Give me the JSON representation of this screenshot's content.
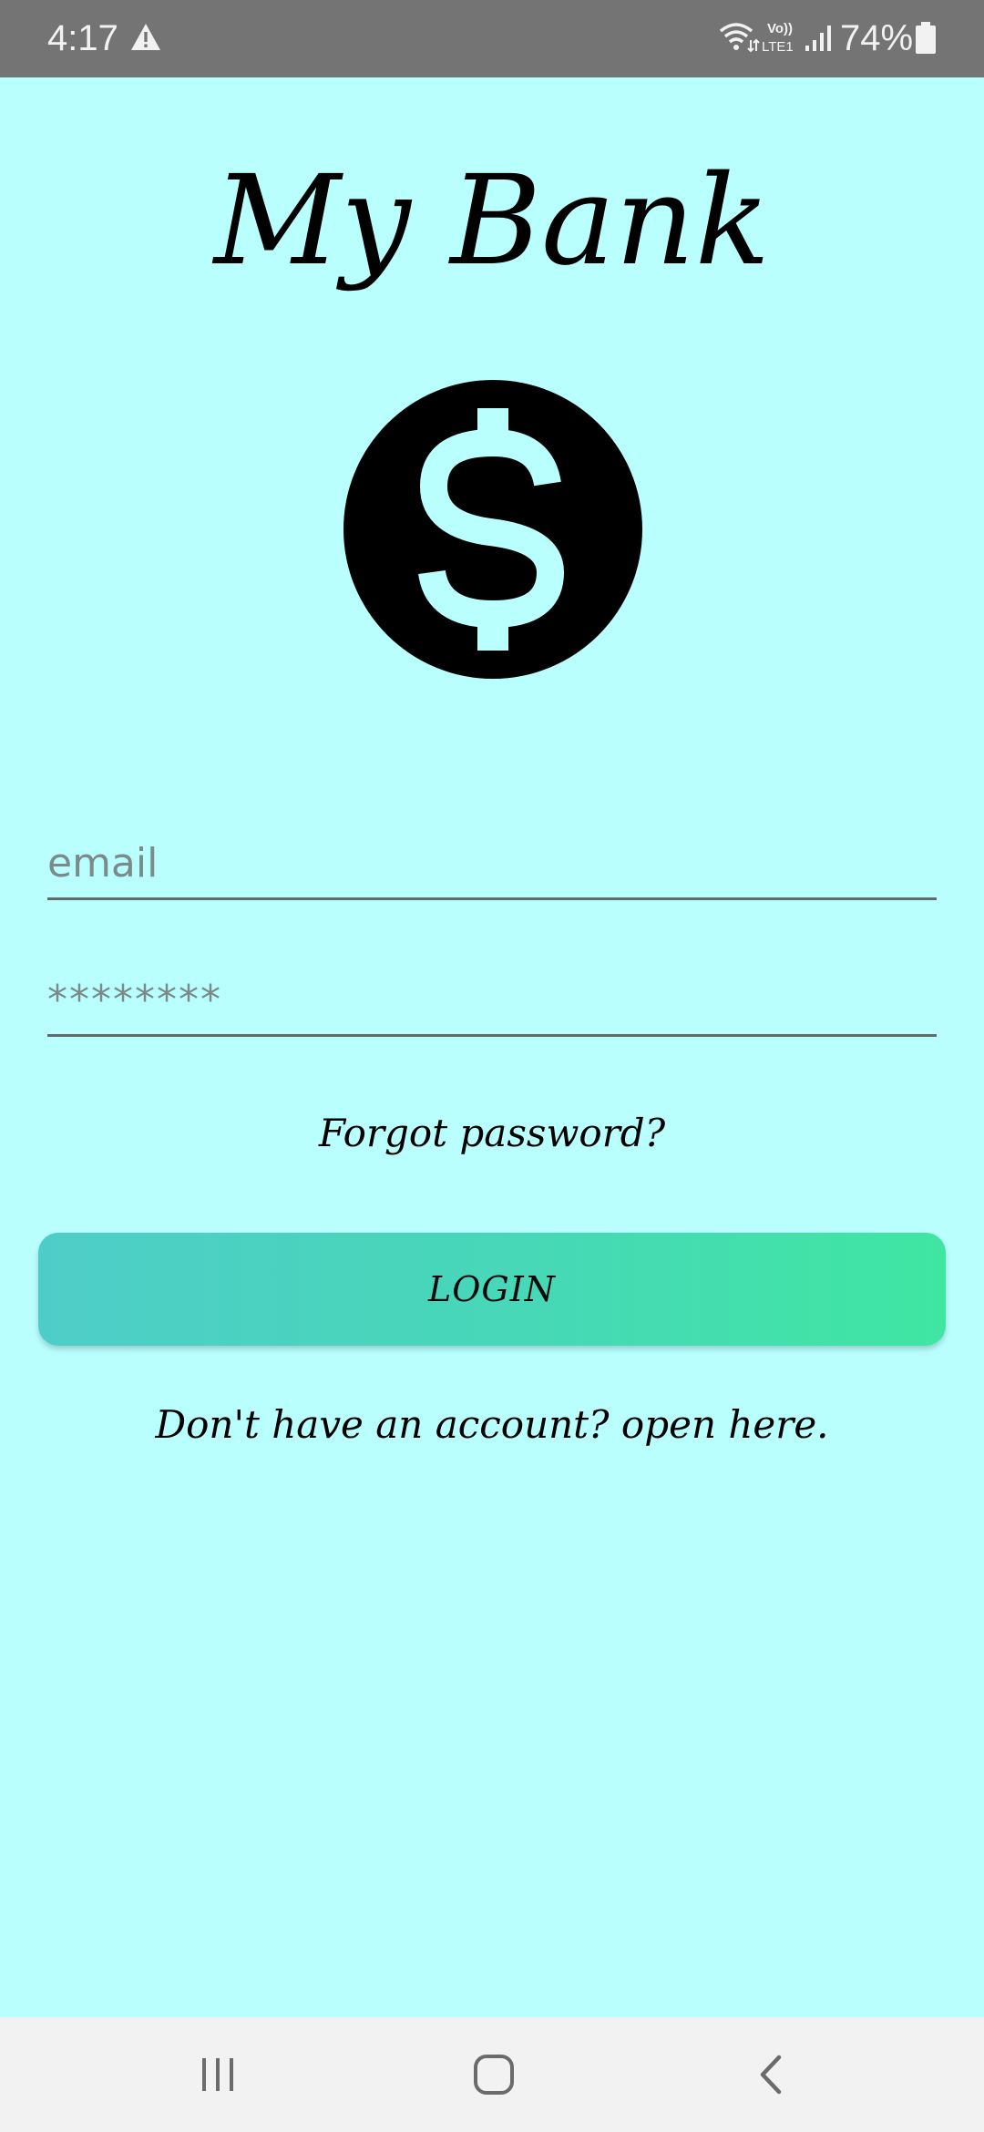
{
  "status_bar": {
    "time": "4:17",
    "battery": "74%",
    "icons": [
      "warning-icon",
      "wifi-icon",
      "volte-lte-icon",
      "signal-icon",
      "battery-icon"
    ],
    "volte_text": "Vo))",
    "lte_text": "LTE1"
  },
  "app": {
    "title": "My Bank",
    "logo_icon": "dollar-sign-icon"
  },
  "form": {
    "email_placeholder": "email",
    "email_value": "",
    "password_placeholder": "********",
    "password_value": "",
    "forgot_label": "Forgot password?",
    "login_label": "LOGIN",
    "signup_label": "Don't have an account? open here."
  },
  "nav_bar": {
    "icons": [
      "recents-icon",
      "home-icon",
      "back-icon"
    ]
  },
  "colors": {
    "background": "#b8fffe",
    "status_bar": "#747474",
    "button_gradient_start": "#4ecdc8",
    "button_gradient_end": "#3fe6a2",
    "nav_bar": "#f2f2f2"
  }
}
